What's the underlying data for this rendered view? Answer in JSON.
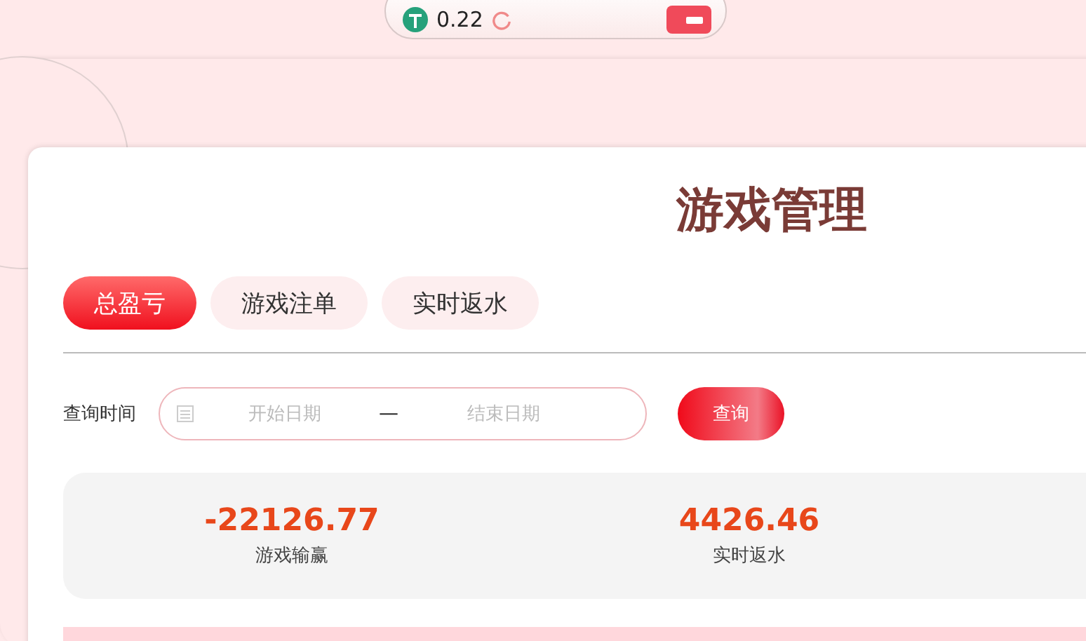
{
  "top_bar": {
    "balance": "0.22"
  },
  "page_title": "游戏管理",
  "tabs": [
    {
      "label": "总盈亏",
      "selected": true
    },
    {
      "label": "游戏注单",
      "selected": false
    },
    {
      "label": "实时返水",
      "selected": false
    }
  ],
  "query": {
    "label": "查询时间",
    "start_placeholder": "开始日期",
    "separator": "—",
    "end_placeholder": "结束日期",
    "button": "查询"
  },
  "stats": [
    {
      "value": "-22126.77",
      "label": "游戏输赢"
    },
    {
      "value": "4426.46",
      "label": "实时返水"
    }
  ]
}
